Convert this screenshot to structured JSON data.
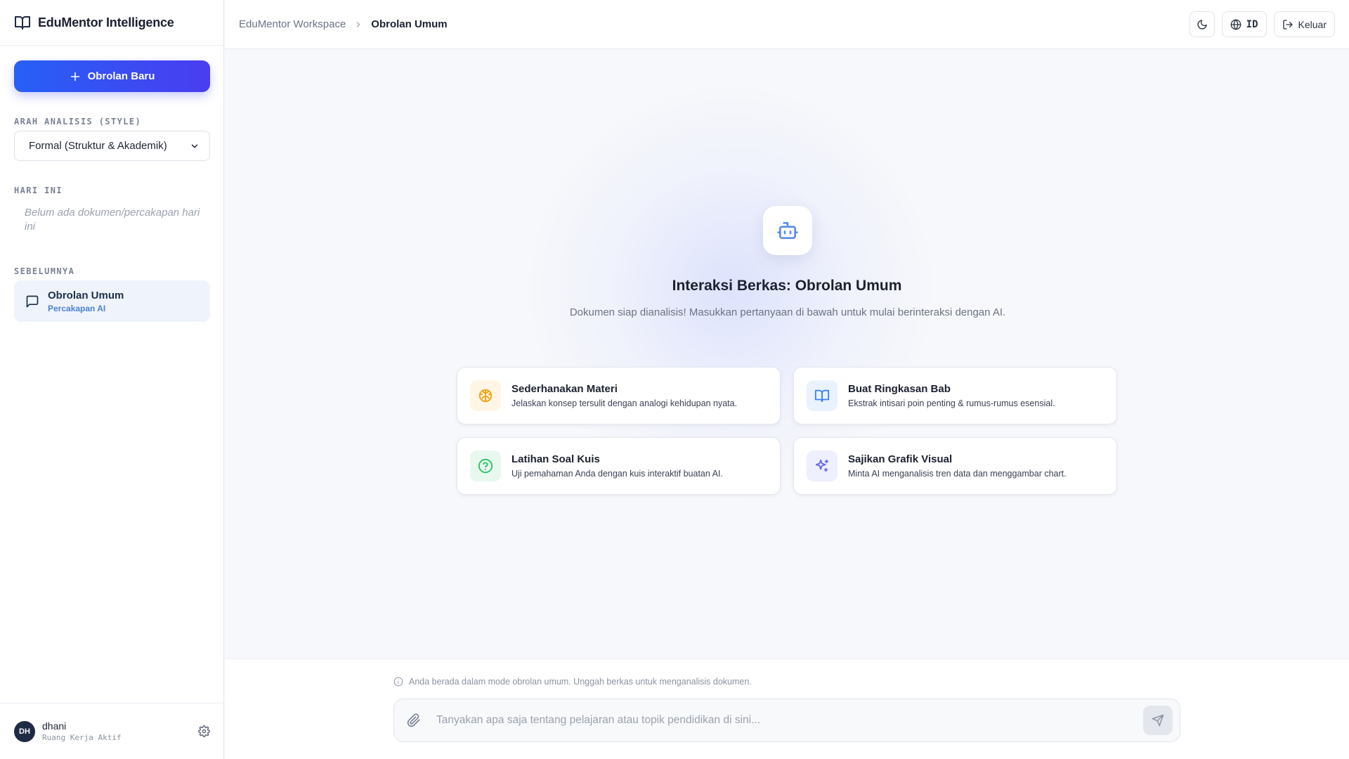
{
  "app": {
    "name": "EduMentor Intelligence",
    "logo_icon": "book-open-icon"
  },
  "sidebar": {
    "new_chat_label": "Obrolan Baru",
    "style_section_label": "ARAH ANALISIS (STYLE)",
    "style_selected": "Formal (Struktur & Akademik)",
    "today_label": "HARI INI",
    "today_empty": "Belum ada dokumen/percakapan hari ini",
    "previous_label": "SEBELUMNYA",
    "history": [
      {
        "title": "Obrolan Umum",
        "subtitle": "Percakapan AI",
        "icon": "message-square-icon"
      }
    ],
    "user": {
      "initials": "DH",
      "name": "dhani",
      "role": "Ruang Kerja Aktif"
    }
  },
  "header": {
    "breadcrumb_root": "EduMentor Workspace",
    "breadcrumb_current": "Obrolan Umum",
    "language": "ID",
    "logout_label": "Keluar"
  },
  "main": {
    "icon": "bot-icon",
    "title": "Interaksi Berkas: Obrolan Umum",
    "subtitle": "Dokumen siap dianalisis! Masukkan pertanyaan di bawah untuk mulai berinteraksi dengan AI.",
    "cards": [
      {
        "title": "Sederhanakan Materi",
        "desc": "Jelaskan konsep tersulit dengan analogi kehidupan nyata.",
        "icon": "brain-icon",
        "color": "#f59e0b",
        "bg": "#fff6e6"
      },
      {
        "title": "Buat Ringkasan Bab",
        "desc": "Ekstrak intisari poin penting & rumus-rumus esensial.",
        "icon": "book-open-icon",
        "color": "#3b82f6",
        "bg": "#eaf2fe"
      },
      {
        "title": "Latihan Soal Kuis",
        "desc": "Uji pemahaman Anda dengan kuis interaktif buatan AI.",
        "icon": "help-circle-icon",
        "color": "#22c55e",
        "bg": "#e9f8ef"
      },
      {
        "title": "Sajikan Grafik Visual",
        "desc": "Minta AI menganalisis tren data dan menggambar chart.",
        "icon": "sparkles-icon",
        "color": "#6366f1",
        "bg": "#eef0fd"
      }
    ]
  },
  "composer": {
    "hint": "Anda berada dalam mode obrolan umum. Unggah berkas untuk menganalisis dokumen.",
    "placeholder": "Tanyakan apa saja tentang pelajaran atau topik pendidikan di sini..."
  },
  "colors": {
    "accent_start": "#2660f6",
    "accent_end": "#4a3df0",
    "avatar_bg": "#1f2a44"
  }
}
